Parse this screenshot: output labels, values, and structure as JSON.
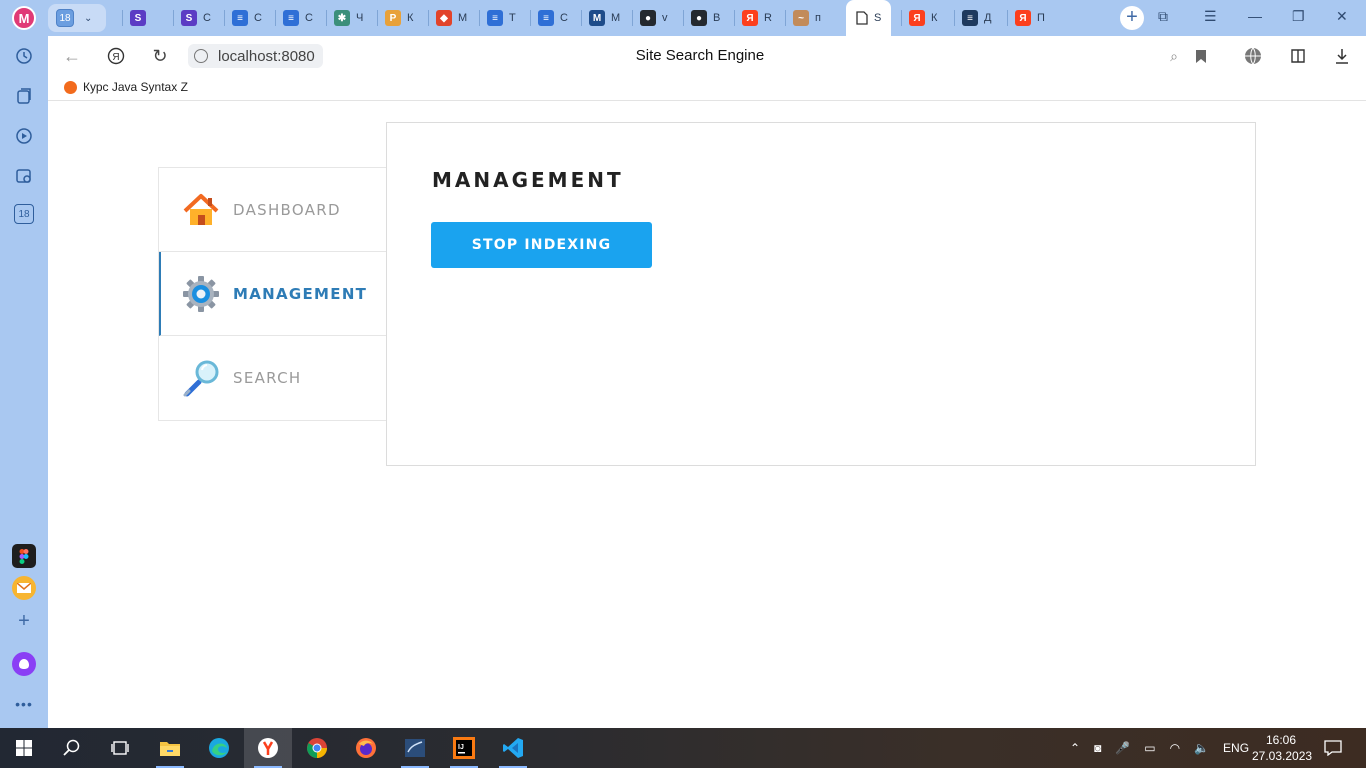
{
  "browser": {
    "profile_initial": "M",
    "pinned_group_count": "18",
    "sidebar_badge": "18",
    "tabs": [
      {
        "letter": "S",
        "text": "",
        "color": "#5b3cc4"
      },
      {
        "letter": "S",
        "text": "С",
        "color": "#5b3cc4"
      },
      {
        "letter": "≡",
        "text": "С",
        "color": "#2f6fd6"
      },
      {
        "letter": "≡",
        "text": "С",
        "color": "#2f6fd6"
      },
      {
        "letter": "✱",
        "text": "Ч",
        "color": "#3b8f7a"
      },
      {
        "letter": "P",
        "text": "К",
        "color": "#e8a13a"
      },
      {
        "letter": "◆",
        "text": "М",
        "color": "#e2432a"
      },
      {
        "letter": "≡",
        "text": "Т",
        "color": "#2f6fd6"
      },
      {
        "letter": "≡",
        "text": "С",
        "color": "#2f6fd6"
      },
      {
        "letter": "M",
        "text": "М",
        "color": "#1e4c8a"
      },
      {
        "letter": "●",
        "text": "v",
        "color": "#24292f"
      },
      {
        "letter": "●",
        "text": "B",
        "color": "#24292f"
      },
      {
        "letter": "Я",
        "text": "R",
        "color": "#fc3f1d"
      },
      {
        "letter": "~",
        "text": "п",
        "color": "#c28b5a"
      }
    ],
    "active_tab": {
      "text": "S"
    },
    "tabs_after": [
      {
        "letter": "Я",
        "text": "К",
        "color": "#fc3f1d"
      },
      {
        "letter": "≡",
        "text": "Д",
        "color": "#1e3a5f"
      },
      {
        "letter": "Я",
        "text": "П",
        "color": "#fc3f1d"
      }
    ],
    "address": "localhost:8080",
    "page_title": "Site Search Engine",
    "bookmark": "Курс Java Syntax Z"
  },
  "app": {
    "nav": [
      {
        "label": "DASHBOARD",
        "icon": "house-icon",
        "active": false
      },
      {
        "label": "MANAGEMENT",
        "icon": "gear-icon",
        "active": true
      },
      {
        "label": "SEARCH",
        "icon": "magnifier-icon",
        "active": false
      }
    ],
    "section_title": "MANAGEMENT",
    "action_button": "STOP INDEXING"
  },
  "taskbar": {
    "language": "ENG",
    "time": "16:06",
    "date": "27.03.2023"
  }
}
